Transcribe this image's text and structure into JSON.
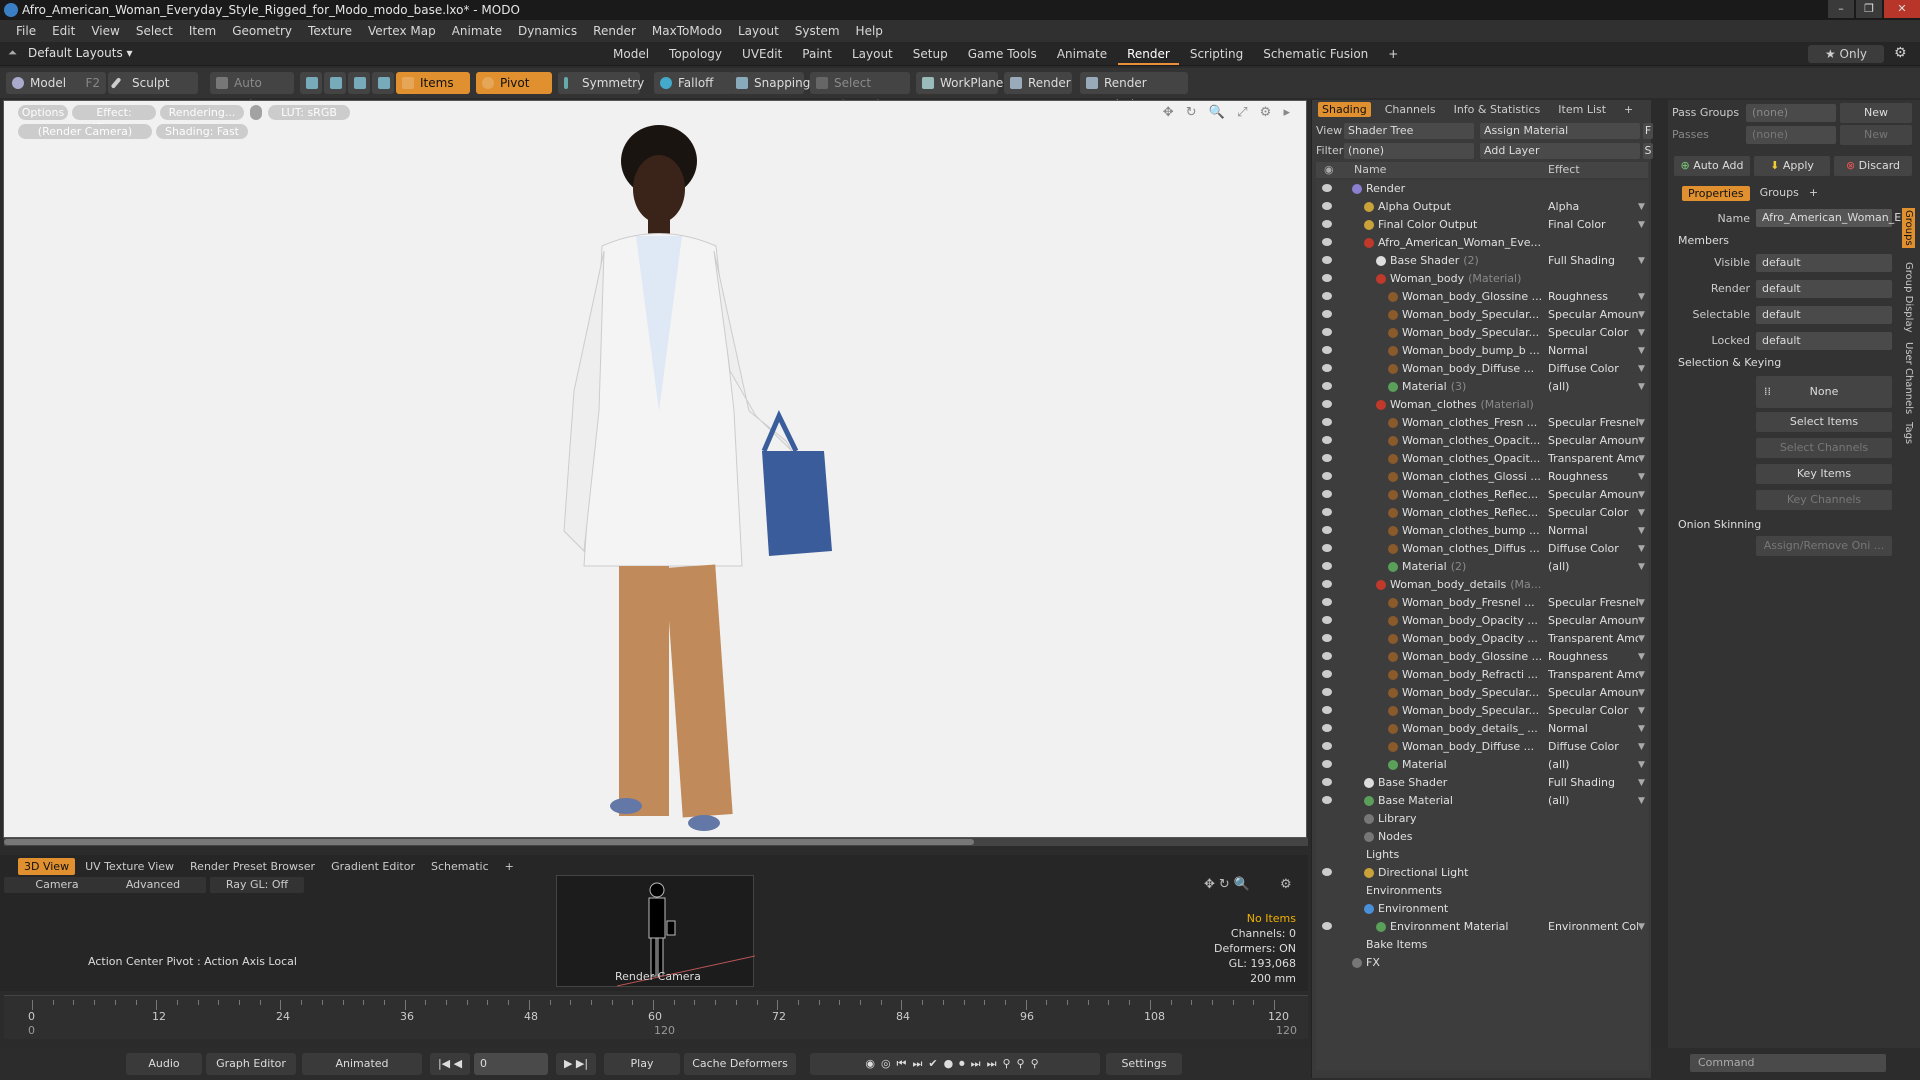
{
  "title": "Afro_American_Woman_Everyday_Style_Rigged_for_Modo_modo_base.lxo* - MODO",
  "menu": [
    "File",
    "Edit",
    "View",
    "Select",
    "Item",
    "Geometry",
    "Texture",
    "Vertex Map",
    "Animate",
    "Dynamics",
    "Render",
    "MaxToModo",
    "Layout",
    "System",
    "Help"
  ],
  "layout": {
    "selector": "Default Layouts ▾",
    "tabs": [
      "Model",
      "Topology",
      "UVEdit",
      "Paint",
      "Layout",
      "Setup",
      "Game Tools",
      "Animate",
      "Render",
      "Scripting",
      "Schematic Fusion",
      "+"
    ],
    "active_tab": "Render",
    "only": "★ Only"
  },
  "toolbar": {
    "model": "Model",
    "model_key": "F2",
    "sculpt": "Sculpt",
    "auto_select": "Auto Select",
    "items": "Items",
    "pivot": "Pivot",
    "symmetry": "Symmetry",
    "falloff": "Falloff",
    "snapping": "Snapping",
    "select_through": "Select Through",
    "workplane": "WorkPlane",
    "render": "Render",
    "render_window": "Render Window"
  },
  "viewport": {
    "buttons": [
      "Options",
      "Effect: (Shadi...",
      "Rendering...",
      "LUT: sRGB",
      "(Render Camera)",
      "Shading: Fast"
    ],
    "icons": "✥ ↻ 🔍 ⤢ ⚙ ▸"
  },
  "bottom": {
    "tabs": [
      "3D View",
      "UV Texture View",
      "Render Preset Browser",
      "Gradient Editor",
      "Schematic",
      "+"
    ],
    "buttons": [
      "Camera",
      "Advanced",
      "Ray GL: Off"
    ],
    "action_center": "Action Center Pivot : Action Axis Local",
    "thumb_label": "Render Camera",
    "stats": [
      "No Items",
      "Channels: 0",
      "Deformers: ON",
      "GL: 193,068",
      "200 mm"
    ]
  },
  "ruler": {
    "labels": [
      "0",
      "12",
      "24",
      "36",
      "48",
      "60",
      "72",
      "84",
      "96",
      "108",
      "120"
    ],
    "lower": [
      "0",
      "120",
      "120"
    ]
  },
  "transport": {
    "audio": "Audio",
    "graph_editor": "Graph Editor",
    "animated": "Animated",
    "frame": "0",
    "play": "Play",
    "cache": "Cache Deformers",
    "settings": "Settings"
  },
  "shading": {
    "tabs": [
      "Shading",
      "Channels",
      "Info & Statistics",
      "Item List",
      "+"
    ],
    "view_label": "View",
    "view_value": "Shader Tree",
    "assign": "Assign Material",
    "assign_key": "F",
    "filter_label": "Filter",
    "filter_value": "(none)",
    "add_layer": "Add Layer",
    "add_layer_key": "S",
    "col_name": "Name",
    "col_effect": "Effect",
    "rows": [
      {
        "name": "Render",
        "effect": "",
        "indent": 0,
        "icon": "#8a7fd0",
        "eye": true
      },
      {
        "name": "Alpha Output",
        "effect": "Alpha",
        "indent": 1,
        "icon": "#c9a33a",
        "eye": true
      },
      {
        "name": "Final Color Output",
        "effect": "Final Color",
        "indent": 1,
        "icon": "#c9a33a",
        "eye": true
      },
      {
        "name": "Afro_American_Woman_Eve...",
        "effect": "",
        "indent": 1,
        "icon": "#c0392b",
        "eye": true
      },
      {
        "name": "Base Shader",
        "suffix": "(2)",
        "effect": "Full Shading",
        "indent": 2,
        "icon": "#ddd",
        "eye": true
      },
      {
        "name": "Woman_body",
        "suffix": "(Material)",
        "effect": "",
        "indent": 2,
        "icon": "#c0392b",
        "eye": true
      },
      {
        "name": "Woman_body_Glossine ...",
        "effect": "Roughness",
        "indent": 3,
        "icon": "#8b5a2b",
        "eye": true
      },
      {
        "name": "Woman_body_Specular...",
        "effect": "Specular Amount",
        "indent": 3,
        "icon": "#8b5a2b",
        "eye": true
      },
      {
        "name": "Woman_body_Specular...",
        "effect": "Specular Color",
        "indent": 3,
        "icon": "#8b5a2b",
        "eye": true
      },
      {
        "name": "Woman_body_bump_b ...",
        "effect": "Normal",
        "indent": 3,
        "icon": "#8b5a2b",
        "eye": true
      },
      {
        "name": "Woman_body_Diffuse ...",
        "effect": "Diffuse Color",
        "indent": 3,
        "icon": "#8b5a2b",
        "eye": true
      },
      {
        "name": "Material",
        "suffix": "(3)",
        "effect": "(all)",
        "indent": 3,
        "icon": "#5aa05a",
        "eye": true
      },
      {
        "name": "Woman_clothes",
        "suffix": "(Material)",
        "effect": "",
        "indent": 2,
        "icon": "#c0392b",
        "eye": true
      },
      {
        "name": "Woman_clothes_Fresn ...",
        "effect": "Specular Fresnel",
        "indent": 3,
        "icon": "#8b5a2b",
        "eye": true
      },
      {
        "name": "Woman_clothes_Opacit...",
        "effect": "Specular Amount",
        "indent": 3,
        "icon": "#8b5a2b",
        "eye": true
      },
      {
        "name": "Woman_clothes_Opacit...",
        "effect": "Transparent Amo...",
        "indent": 3,
        "icon": "#8b5a2b",
        "eye": true
      },
      {
        "name": "Woman_clothes_Glossi ...",
        "effect": "Roughness",
        "indent": 3,
        "icon": "#8b5a2b",
        "eye": true
      },
      {
        "name": "Woman_clothes_Reflec...",
        "effect": "Specular Amount",
        "indent": 3,
        "icon": "#8b5a2b",
        "eye": true
      },
      {
        "name": "Woman_clothes_Reflec...",
        "effect": "Specular Color",
        "indent": 3,
        "icon": "#8b5a2b",
        "eye": true
      },
      {
        "name": "Woman_clothes_bump ...",
        "effect": "Normal",
        "indent": 3,
        "icon": "#8b5a2b",
        "eye": true
      },
      {
        "name": "Woman_clothes_Diffus ...",
        "effect": "Diffuse Color",
        "indent": 3,
        "icon": "#8b5a2b",
        "eye": true
      },
      {
        "name": "Material",
        "suffix": "(2)",
        "effect": "(all)",
        "indent": 3,
        "icon": "#5aa05a",
        "eye": true
      },
      {
        "name": "Woman_body_details",
        "suffix": "(Ma...",
        "effect": "",
        "indent": 2,
        "icon": "#c0392b",
        "eye": true
      },
      {
        "name": "Woman_body_Fresnel ...",
        "effect": "Specular Fresnel",
        "indent": 3,
        "icon": "#8b5a2b",
        "eye": true
      },
      {
        "name": "Woman_body_Opacity ...",
        "effect": "Specular Amount",
        "indent": 3,
        "icon": "#8b5a2b",
        "eye": true
      },
      {
        "name": "Woman_body_Opacity ...",
        "effect": "Transparent Amo...",
        "indent": 3,
        "icon": "#8b5a2b",
        "eye": true
      },
      {
        "name": "Woman_body_Glossine ...",
        "effect": "Roughness",
        "indent": 3,
        "icon": "#8b5a2b",
        "eye": true
      },
      {
        "name": "Woman_body_Refracti ...",
        "effect": "Transparent Amo...",
        "indent": 3,
        "icon": "#8b5a2b",
        "eye": true
      },
      {
        "name": "Woman_body_Specular...",
        "effect": "Specular Amount",
        "indent": 3,
        "icon": "#8b5a2b",
        "eye": true
      },
      {
        "name": "Woman_body_Specular...",
        "effect": "Specular Color",
        "indent": 3,
        "icon": "#8b5a2b",
        "eye": true
      },
      {
        "name": "Woman_body_details_ ...",
        "effect": "Normal",
        "indent": 3,
        "icon": "#8b5a2b",
        "eye": true
      },
      {
        "name": "Woman_body_Diffuse ...",
        "effect": "Diffuse Color",
        "indent": 3,
        "icon": "#8b5a2b",
        "eye": true
      },
      {
        "name": "Material",
        "effect": "(all)",
        "indent": 3,
        "icon": "#5aa05a",
        "eye": true
      },
      {
        "name": "Base Shader",
        "effect": "Full Shading",
        "indent": 1,
        "icon": "#ddd",
        "eye": true
      },
      {
        "name": "Base Material",
        "effect": "(all)",
        "indent": 1,
        "icon": "#5aa05a",
        "eye": true
      },
      {
        "name": "Library",
        "effect": "",
        "indent": 1,
        "icon": "#777",
        "eye": false
      },
      {
        "name": "Nodes",
        "effect": "",
        "indent": 1,
        "icon": "#777",
        "eye": false
      },
      {
        "name": "Lights",
        "effect": "",
        "indent": 0,
        "icon": "",
        "eye": false
      },
      {
        "name": "Directional Light",
        "effect": "",
        "indent": 1,
        "icon": "#c9a33a",
        "eye": true
      },
      {
        "name": "Environments",
        "effect": "",
        "indent": 0,
        "icon": "",
        "eye": false
      },
      {
        "name": "Environment",
        "effect": "",
        "indent": 1,
        "icon": "#4a90d9",
        "eye": false
      },
      {
        "name": "Environment Material",
        "effect": "Environment Color",
        "indent": 2,
        "icon": "#5aa05a",
        "eye": true
      },
      {
        "name": "Bake Items",
        "effect": "",
        "indent": 0,
        "icon": "",
        "eye": false
      },
      {
        "name": "FX",
        "effect": "",
        "indent": 0,
        "icon": "#777",
        "eye": false
      }
    ]
  },
  "props": {
    "pass_groups": "Pass Groups",
    "pass_groups_value": "(none)",
    "new": "New",
    "passes": "Passes",
    "passes_value": "(none)",
    "new2": "New",
    "auto_add": "Auto Add",
    "apply": "Apply",
    "discard": "Discard",
    "tabs": [
      "Properties",
      "Groups",
      "+"
    ],
    "name_label": "Name",
    "name_value": "Afro_American_Woman_E",
    "members": "Members",
    "fields": [
      {
        "label": "Visible",
        "value": "default"
      },
      {
        "label": "Render",
        "value": "default"
      },
      {
        "label": "Selectable",
        "value": "default"
      },
      {
        "label": "Locked",
        "value": "default"
      }
    ],
    "selection_keying": "Selection & Keying",
    "none": "None",
    "select_items": "Select Items",
    "select_channels": "Select Channels",
    "key_items": "Key Items",
    "key_channels": "Key Channels",
    "onion": "Onion Skinning",
    "assign_remove": "Assign/Remove Oni ...",
    "side_tabs": [
      "Groups",
      "Group Display",
      "User Channels",
      "Tags"
    ],
    "command": "Command"
  }
}
